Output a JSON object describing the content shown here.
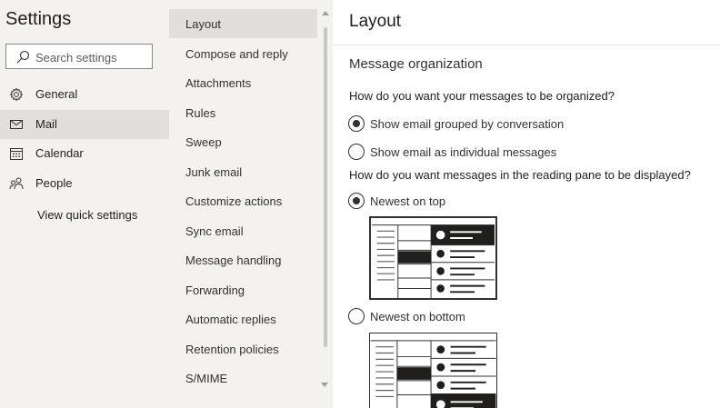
{
  "sidebar": {
    "title": "Settings",
    "search_placeholder": "Search settings",
    "items": [
      {
        "label": "General",
        "icon": "gear-icon"
      },
      {
        "label": "Mail",
        "icon": "mail-icon"
      },
      {
        "label": "Calendar",
        "icon": "calendar-icon"
      },
      {
        "label": "People",
        "icon": "people-icon"
      }
    ],
    "selected": "Mail",
    "quick_settings": "View quick settings"
  },
  "mail_menu": {
    "items": [
      "Layout",
      "Compose and reply",
      "Attachments",
      "Rules",
      "Sweep",
      "Junk email",
      "Customize actions",
      "Sync email",
      "Message handling",
      "Forwarding",
      "Automatic replies",
      "Retention policies",
      "S/MIME"
    ],
    "selected": "Layout"
  },
  "content": {
    "title": "Layout",
    "section": "Message organization",
    "q1": "How do you want your messages to be organized?",
    "q1_options": [
      {
        "label": "Show email grouped by conversation",
        "checked": true
      },
      {
        "label": "Show email as individual messages",
        "checked": false
      }
    ],
    "q2": "How do you want messages in the reading pane to be displayed?",
    "q2_options": [
      {
        "label": "Newest on top",
        "checked": true
      },
      {
        "label": "Newest on bottom",
        "checked": false
      }
    ]
  },
  "colors": {
    "pane_bg": "#f3f2f1",
    "selected_bg": "#e1dfdd",
    "content_bg": "#ffffff",
    "text": "#201f1e"
  }
}
